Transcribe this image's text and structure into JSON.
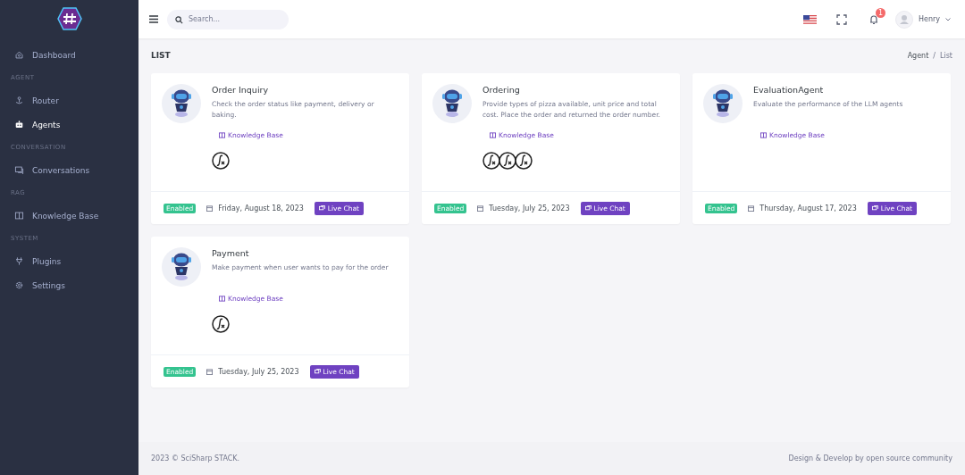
{
  "sidebar": {
    "sections": [
      {
        "items": [
          {
            "label": "Dashboard",
            "selected": false
          }
        ]
      },
      {
        "heading": "AGENT",
        "items": [
          {
            "label": "Router",
            "selected": false
          },
          {
            "label": "Agents",
            "selected": true
          }
        ]
      },
      {
        "heading": "CONVERSATION",
        "items": [
          {
            "label": "Conversations",
            "selected": false
          }
        ]
      },
      {
        "heading": "RAG",
        "items": [
          {
            "label": "Knowledge Base",
            "selected": false
          }
        ]
      },
      {
        "heading": "SYSTEM",
        "items": [
          {
            "label": "Plugins",
            "selected": false
          },
          {
            "label": "Settings",
            "selected": false
          }
        ]
      }
    ]
  },
  "topbar": {
    "search": {
      "placeholder": "Search..."
    },
    "notification_count": "1",
    "user": "Henry"
  },
  "page": {
    "title": "LIST",
    "breadcrumb": [
      "Agent",
      "List"
    ],
    "breadcrumb_separator": "/"
  },
  "agents": [
    {
      "name": "Order Inquiry",
      "description": "Check the order status like payment, delivery or baking.",
      "knowledge_link": "Knowledge Base",
      "functions": [
        {
          "kind": "function"
        }
      ],
      "status": "Enabled",
      "date": "Friday, August 18, 2023",
      "action": "Live Chat"
    },
    {
      "name": "Ordering",
      "description": "Provide types of pizza available, unit price and total cost. Place the order and returned the order number.",
      "knowledge_link": "Knowledge Base",
      "functions": [
        {
          "kind": "function"
        },
        {
          "kind": "function"
        },
        {
          "kind": "function"
        }
      ],
      "status": "Enabled",
      "date": "Tuesday, July 25, 2023",
      "action": "Live Chat"
    },
    {
      "name": "EvaluationAgent",
      "description": "Evaluate the performance of the LLM agents",
      "knowledge_link": "Knowledge Base",
      "status": "Enabled",
      "date": "Thursday, August 17, 2023",
      "action": "Live Chat"
    },
    {
      "name": "Payment",
      "description": "Make payment when user wants to pay for the order",
      "knowledge_link": "Knowledge Base",
      "functions": [
        {
          "kind": "function"
        }
      ],
      "status": "Enabled",
      "date": "Tuesday, July 25, 2023",
      "action": "Live Chat"
    }
  ],
  "footer": {
    "left": "2023 © SciSharp STACK.",
    "right": "Design & Develop by open source community"
  }
}
